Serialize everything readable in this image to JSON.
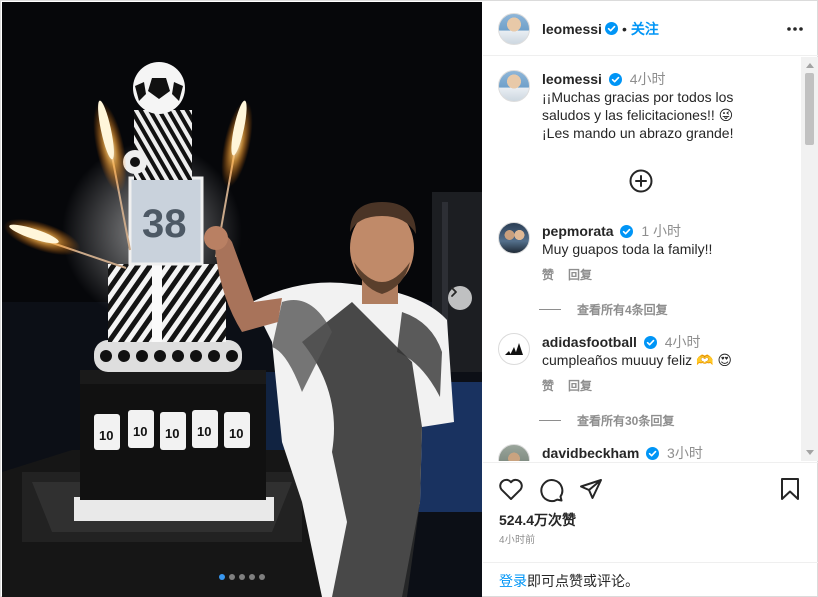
{
  "post": {
    "username": "leomessi",
    "separator": "•",
    "follow_label": "关注",
    "dots": 5,
    "active_dot": 0
  },
  "colors": {
    "accent": "#0095f6",
    "verified": "#0095f6",
    "muted": "#8e8e8e",
    "heart_red": "#ed4956"
  },
  "caption": {
    "username": "leomessi",
    "time": "4小时",
    "lines": [
      "¡¡Muchas gracias por todos los",
      "saludos y las felicitaciones!! 😜",
      "¡Les mando un abrazo grande!"
    ]
  },
  "comments": [
    {
      "username": "pepmorata",
      "time": "1 小时",
      "text": "Muy guapos toda la family!!",
      "like_label": "赞",
      "reply_label": "回复",
      "view_replies": "查看所有4条回复"
    },
    {
      "username": "adidasfootball",
      "time": "4小时",
      "text": "cumpleaños muuuy feliz 🫶 😍",
      "like_label": "赞",
      "reply_label": "回复",
      "view_replies": "查看所有30条回复"
    },
    {
      "username": "davidbeckham",
      "time": "3小时",
      "text": "",
      "like_label": "",
      "reply_label": "",
      "view_replies": ""
    }
  ],
  "footer": {
    "likes": "524.4万次赞",
    "posted": "4小时前",
    "login_link": "登录",
    "login_text": "即可点赞或评论。"
  },
  "icons": {
    "header_more": "more-horizontal-icon",
    "add": "add-circle-icon",
    "like": "heart-outline-icon",
    "comment": "comment-bubble-icon",
    "share": "paper-plane-icon",
    "save": "bookmark-icon",
    "next": "chevron-right-icon",
    "verified": "verified-badge-icon"
  }
}
